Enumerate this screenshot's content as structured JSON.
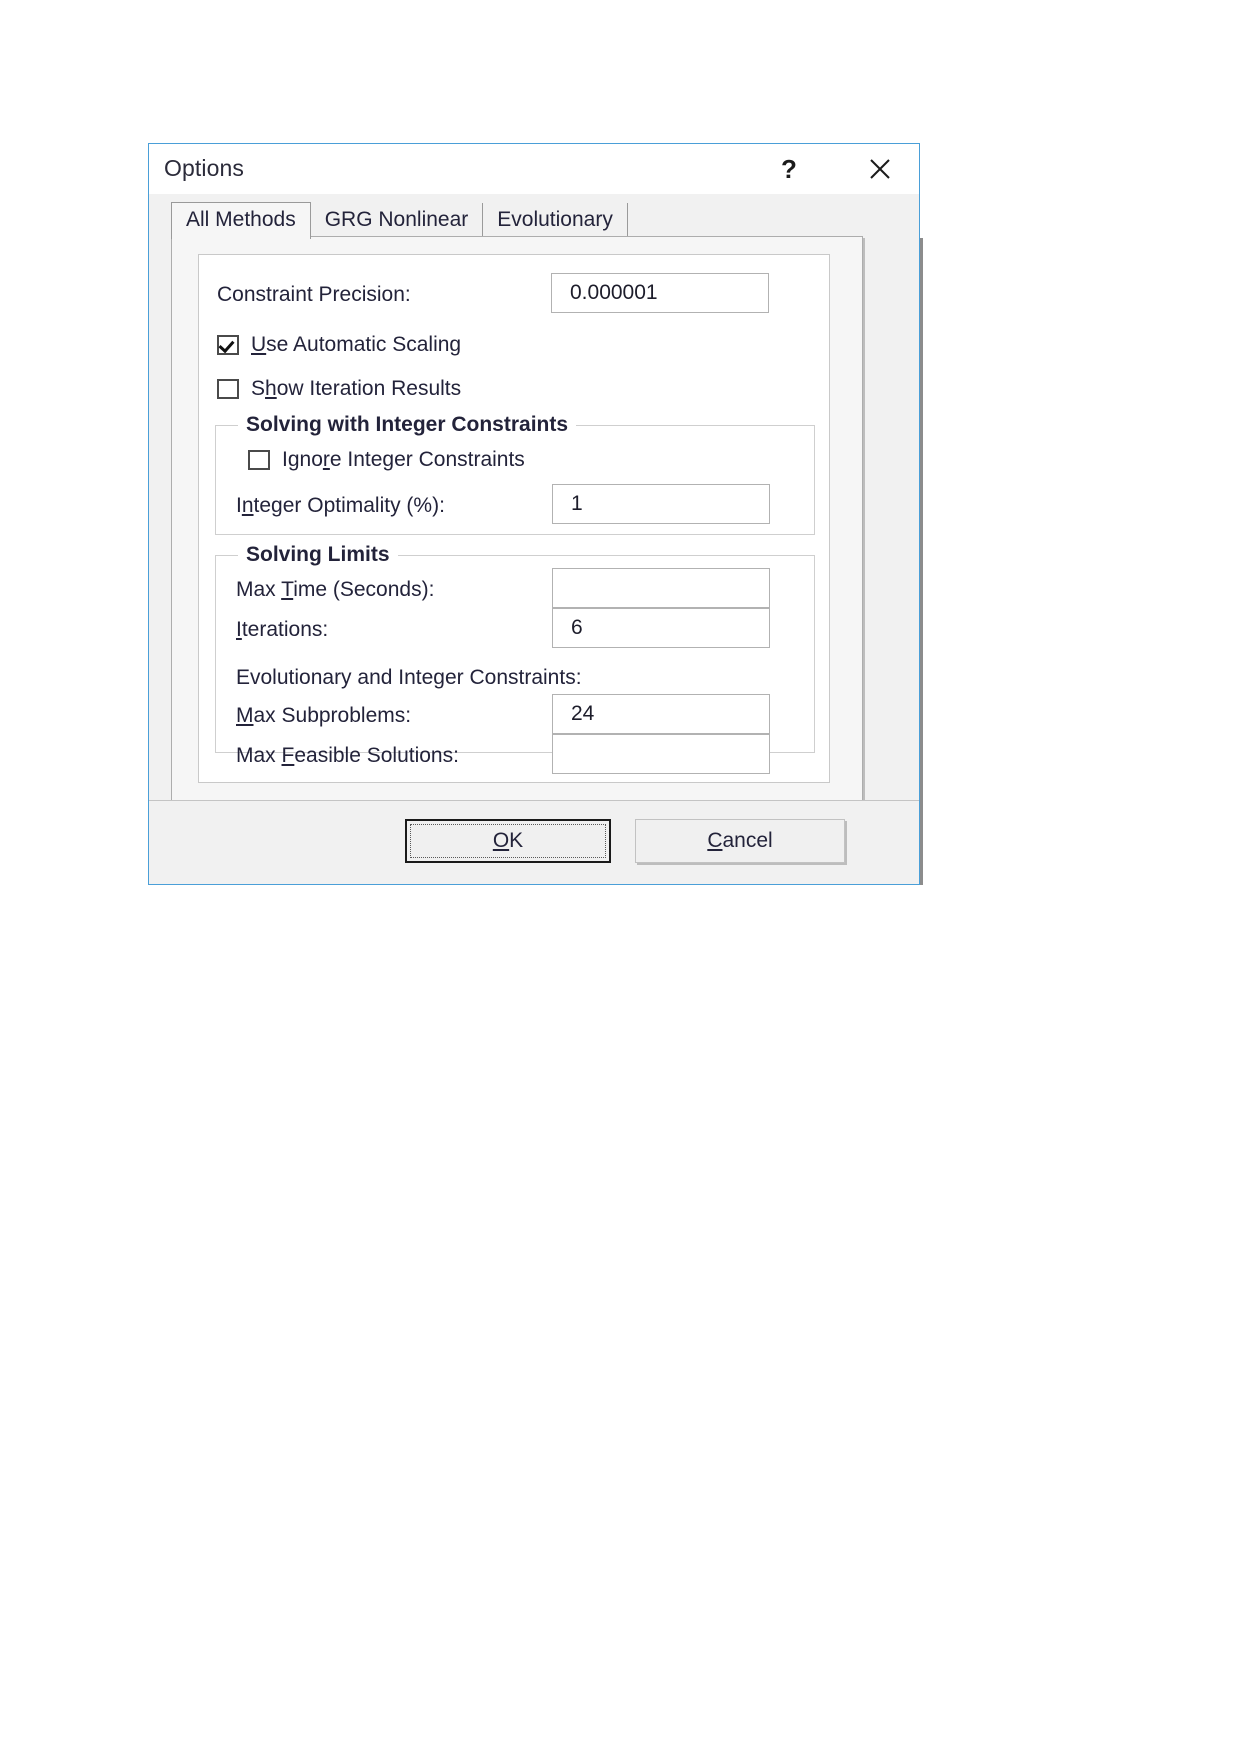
{
  "window": {
    "title": "Options",
    "help_icon": "question-mark-icon",
    "help_label": "?",
    "close_icon": "close-x-icon",
    "accent_border": "#4a9fd8"
  },
  "tabs": [
    {
      "label": "All Methods",
      "active": true
    },
    {
      "label": "GRG Nonlinear",
      "active": false
    },
    {
      "label": "Evolutionary",
      "active": false
    }
  ],
  "all_methods": {
    "constraint_precision": {
      "label": "Constraint Precision:",
      "value": "0.000001"
    },
    "use_automatic_scaling": {
      "label": "Use Automatic Scaling",
      "checked": true
    },
    "show_iteration_results": {
      "label": "Show Iteration Results",
      "checked": false
    },
    "integer_group": {
      "title": "Solving with Integer Constraints",
      "ignore_integer_constraints": {
        "label": "Ignore Integer Constraints",
        "checked": false
      },
      "integer_optimality": {
        "label": "Integer Optimality (%):",
        "value": "1"
      }
    },
    "solving_limits_group": {
      "title": "Solving Limits",
      "max_time": {
        "label": "Max Time (Seconds):",
        "value": ""
      },
      "iterations": {
        "label": "Iterations:",
        "value": "6"
      },
      "evolutionary_heading": "Evolutionary and Integer Constraints:",
      "max_subproblems": {
        "label": "Max Subproblems:",
        "value": "24"
      },
      "max_feasible_solutions": {
        "label": "Max Feasible Solutions:",
        "value": ""
      }
    }
  },
  "footer": {
    "ok_label": "OK",
    "cancel_label": "Cancel"
  }
}
